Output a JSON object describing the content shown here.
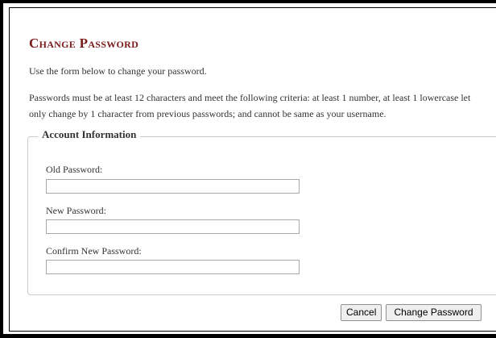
{
  "page": {
    "title": "Change Password",
    "intro": "Use the form below to change your password.",
    "criteria_line1": "Passwords must be at least 12 characters and meet the following criteria: at least 1 number, at least 1 lowercase let",
    "criteria_line2": "only change by 1 character from previous passwords; and cannot be same as your username."
  },
  "form": {
    "legend": "Account Information",
    "old_password_label": "Old Password:",
    "old_password_value": "",
    "new_password_label": "New Password:",
    "new_password_value": "",
    "confirm_password_label": "Confirm New Password:",
    "confirm_password_value": ""
  },
  "buttons": {
    "cancel": "Cancel",
    "change_password": "Change Password"
  },
  "colors": {
    "title": "#7a1a1a",
    "text": "#333333",
    "border": "#000000",
    "fieldset_border": "#cccccc"
  }
}
